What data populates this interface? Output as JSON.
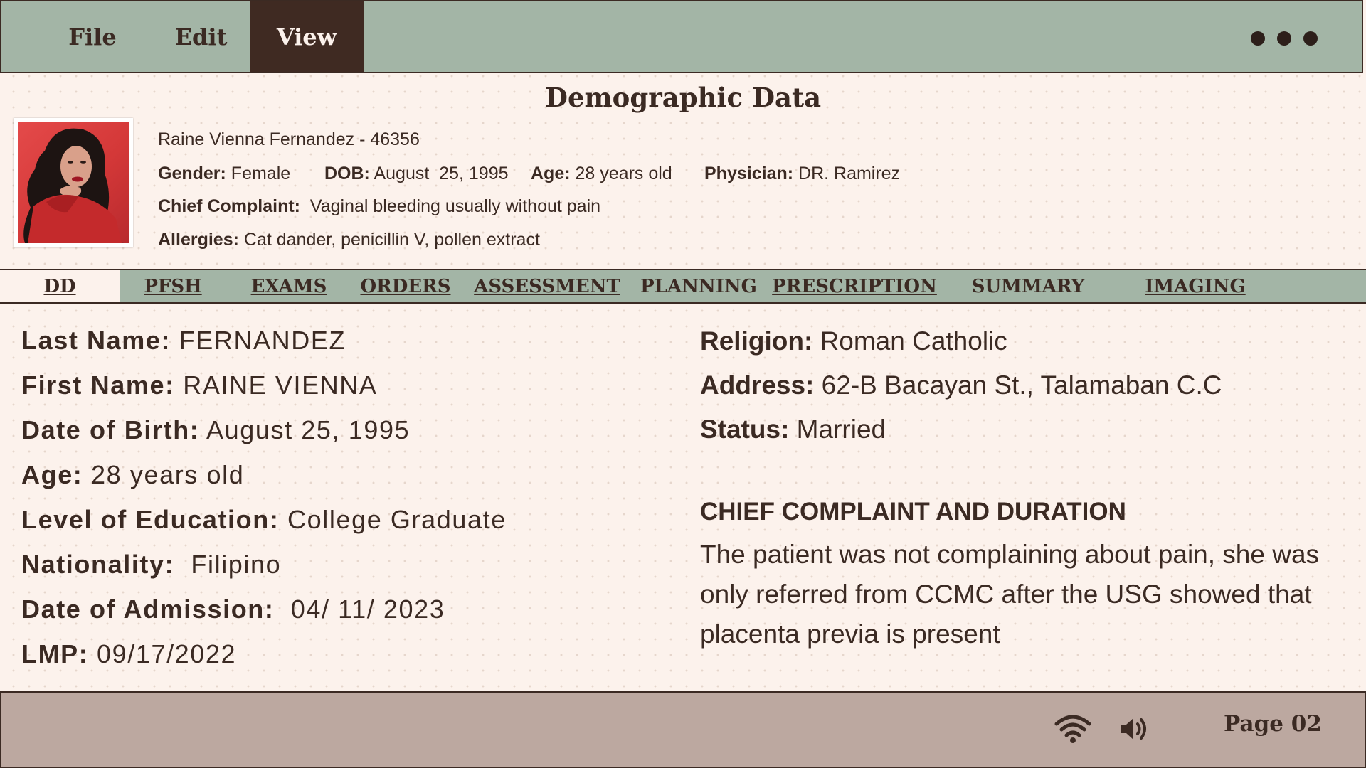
{
  "menu": {
    "items": [
      {
        "label": "File"
      },
      {
        "label": "Edit"
      },
      {
        "label": "View"
      }
    ],
    "active": "View",
    "more_icon": "more-dots-icon"
  },
  "header": {
    "title": "Demographic Data",
    "patient_line": "Raine Vienna Fernandez - 46356",
    "gender_label": "Gender:",
    "gender_value": " Female",
    "dob_label": "DOB:",
    "dob_value": " August  25, 1995",
    "age_label": "Age:",
    "age_value": " 28 years old",
    "physician_label": "Physician:",
    "physician_value": " DR. Ramirez",
    "complaint_label": "Chief Complaint:",
    "complaint_value": "  Vaginal bleeding usually without pain",
    "allergies_label": "Allergies:",
    "allergies_value": " Cat dander, penicillin V, pollen extract"
  },
  "tabs": [
    {
      "label": "DD"
    },
    {
      "label": "PFSH"
    },
    {
      "label": "EXAMS"
    },
    {
      "label": "ORDERS"
    },
    {
      "label": "ASSESSMENT"
    },
    {
      "label": "PLANNING"
    },
    {
      "label": "PRESCRIPTION"
    },
    {
      "label": "SUMMARY"
    },
    {
      "label": "IMAGING"
    }
  ],
  "details_left": [
    {
      "label": "Last Name:",
      "value": " FERNANDEZ"
    },
    {
      "label": "First Name:",
      "value": " RAINE VIENNA"
    },
    {
      "label": "Date of Birth:",
      "value": " August 25, 1995"
    },
    {
      "label": "Age:",
      "value": " 28 years old"
    },
    {
      "label": "Level of Education:",
      "value": " College Graduate"
    },
    {
      "label": "Nationality:",
      "value": "  Filipino"
    },
    {
      "label": "Date of Admission:",
      "value": "  04/ 11/ 2023"
    },
    {
      "label": "LMP:",
      "value": " 09/17/2022"
    }
  ],
  "details_right": [
    {
      "label": "Religion:",
      "value": " Roman Catholic"
    },
    {
      "label": "Address:",
      "value": " 62-B Bacayan St., Talamaban C.C"
    },
    {
      "label": "Status:",
      "value": " Married"
    }
  ],
  "chief_complaint": {
    "heading": "CHIEF COMPLAINT AND DURATION",
    "text": "The patient was not complaining about pain, she was only referred from CCMC after the USG showed that placenta previa is present"
  },
  "status_bar": {
    "wifi_icon": "wifi-icon",
    "volume_icon": "volume-icon",
    "page_label": "Page 02"
  },
  "colors": {
    "menu_bg": "#a3b5a6",
    "active_menu_bg": "#3f2a22",
    "page_bg": "#fcf2ec",
    "status_bg": "#bca8a0",
    "text": "#3b2a23"
  }
}
